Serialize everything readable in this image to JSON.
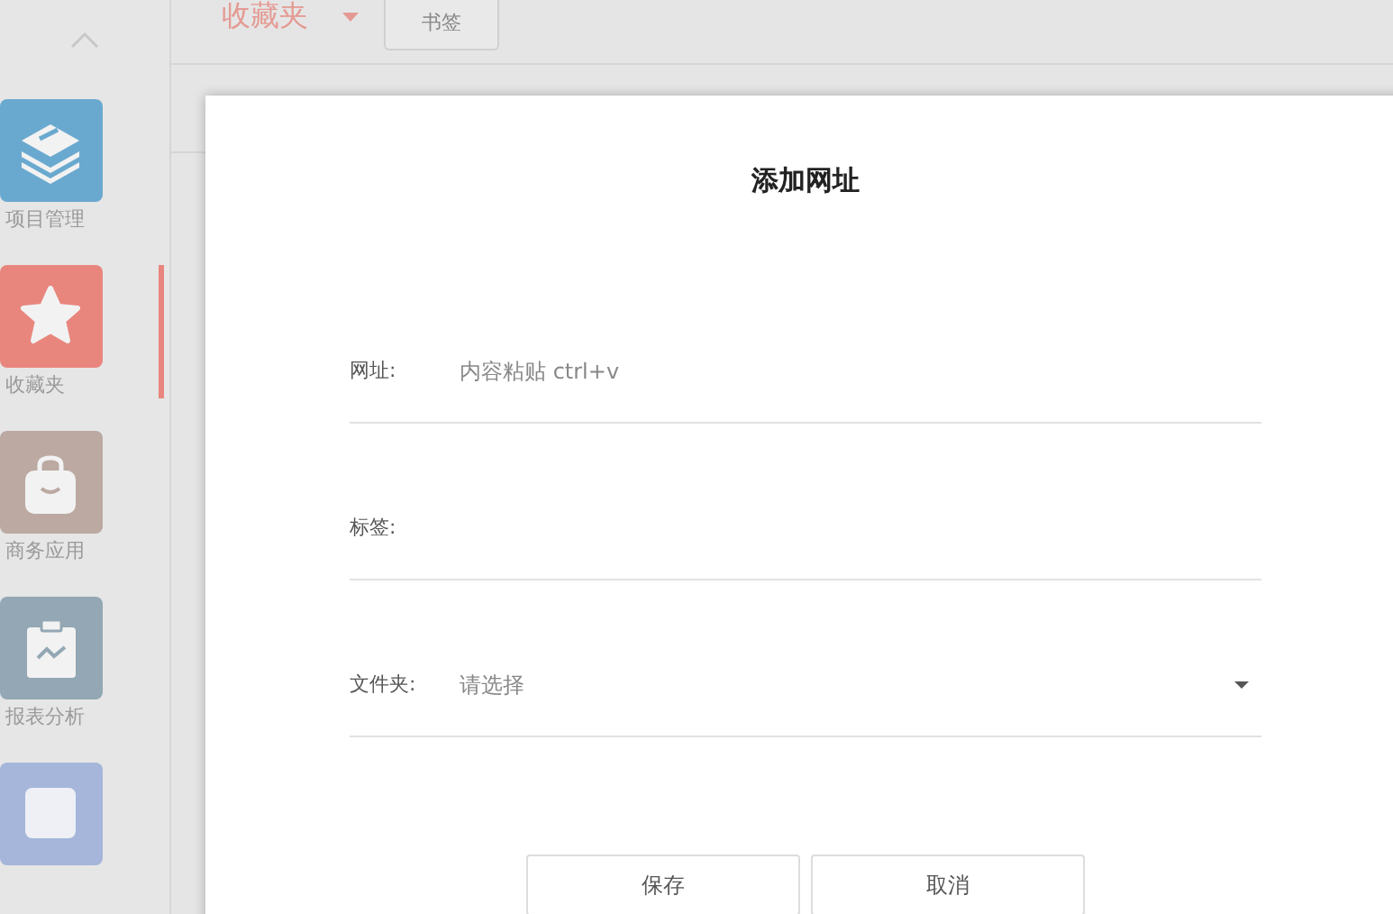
{
  "sidebar": {
    "items": [
      {
        "kind": "layers",
        "label": "项目管理",
        "color": "#6aa9cf",
        "selected": false
      },
      {
        "kind": "star",
        "label": "收藏夹",
        "color": "#e8867e",
        "selected": true
      },
      {
        "kind": "bag",
        "label": "商务应用",
        "color": "#bba9a2",
        "selected": false
      },
      {
        "kind": "report",
        "label": "报表分析",
        "color": "#93a7b4",
        "selected": false
      },
      {
        "kind": "blank",
        "color": "#a5b6da",
        "selected": false
      }
    ]
  },
  "header": {
    "title": "收藏夹",
    "tabs": [
      {
        "label": "书签",
        "selected": false
      }
    ]
  },
  "dialog": {
    "title": "添加网址",
    "fields": [
      {
        "kind": "text",
        "label": "网址:",
        "placeholder": "内容粘贴 ctrl+v"
      },
      {
        "kind": "text",
        "label": "标签:"
      },
      {
        "kind": "select",
        "label": "文件夹:",
        "placeholder": "请选择"
      }
    ],
    "buttons": [
      "保存",
      "取消"
    ]
  }
}
